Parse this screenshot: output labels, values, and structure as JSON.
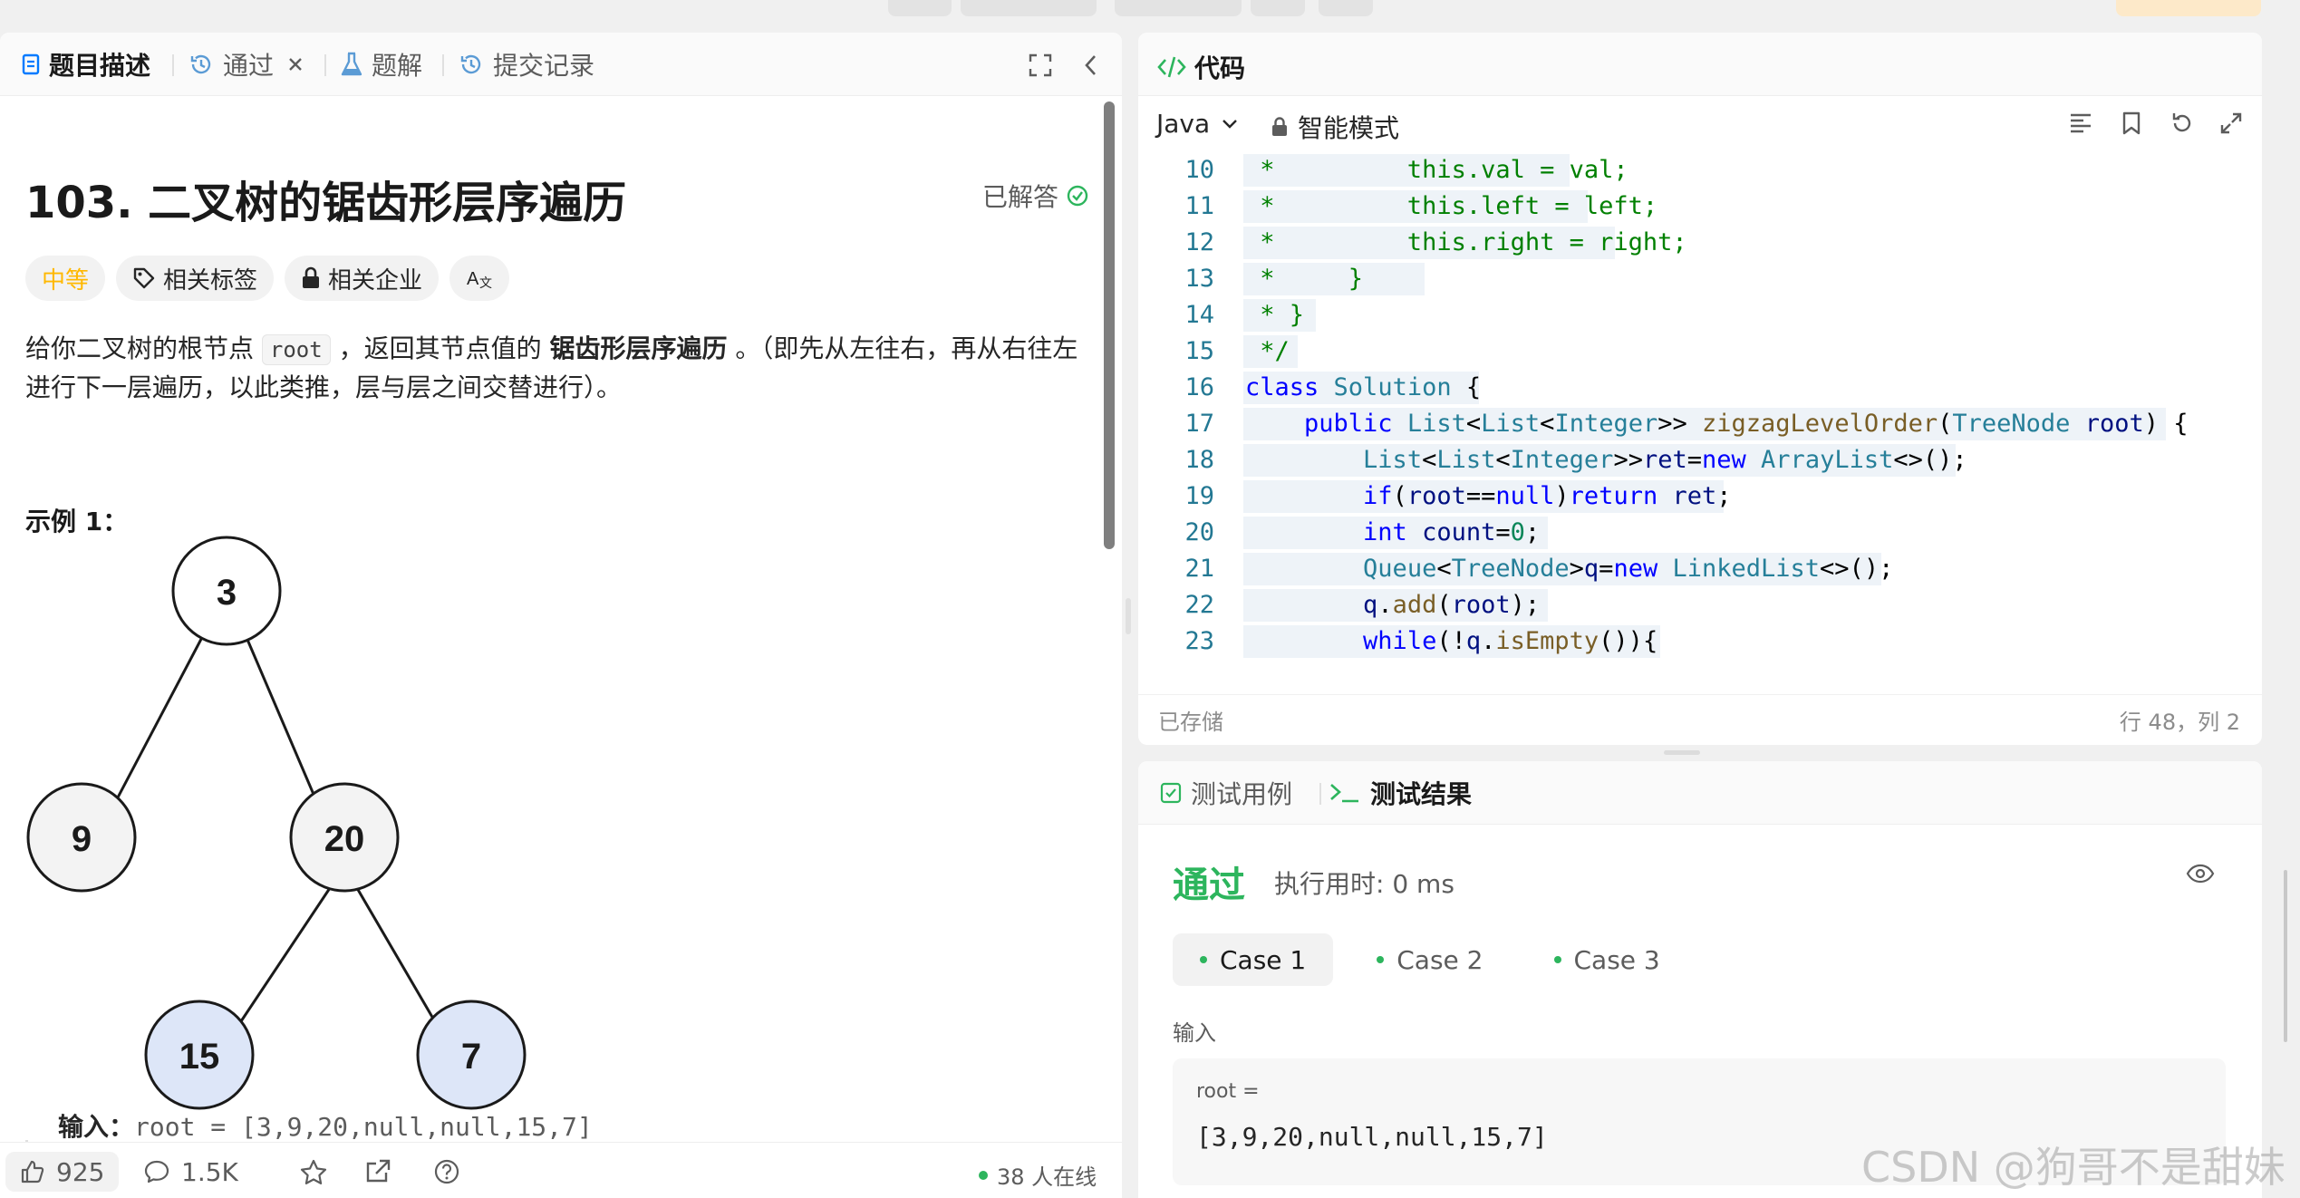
{
  "left_tabs": [
    {
      "label": "题目描述",
      "icon": "description-icon",
      "active": true
    },
    {
      "label": "通过",
      "icon": "history-icon",
      "closable": true
    },
    {
      "label": "题解",
      "icon": "flask-icon"
    },
    {
      "label": "提交记录",
      "icon": "history-icon"
    }
  ],
  "problem": {
    "title": "103. 二叉树的锯齿形层序遍历",
    "status": "已解答",
    "difficulty": "中等",
    "tags": [
      "相关标签",
      "相关企业"
    ],
    "desc_1": "给你二叉树的根节点 ",
    "desc_code": "root",
    "desc_2": " ，返回其节点值的 ",
    "desc_bold": "锯齿形层序遍历",
    "desc_3": " 。（即先从左往右，再从右往左进行下一层遍历，以此类推，层与层之间交替进行）。",
    "example_title": "示例 1：",
    "tree_nodes": [
      "3",
      "9",
      "20",
      "15",
      "7"
    ],
    "input_label": "输入：",
    "input_value": "root = [3,9,20,null,null,15,7]"
  },
  "bottom_bar": {
    "likes": "925",
    "comments": "1.5K",
    "online": "38 人在线"
  },
  "code_panel": {
    "title": "代码",
    "language": "Java",
    "mode": "智能模式",
    "saved": "已存储",
    "cursor": "行 48，列 2"
  },
  "code_lines": [
    {
      "n": "10",
      "t": " *         this.val = val;"
    },
    {
      "n": "11",
      "t": " *         this.left = left;"
    },
    {
      "n": "12",
      "t": " *         this.right = right;"
    },
    {
      "n": "13",
      "t": " *     }"
    },
    {
      "n": "14",
      "t": " * }"
    },
    {
      "n": "15",
      "t": " */"
    },
    {
      "n": "16",
      "t": "class Solution {"
    },
    {
      "n": "17",
      "t": "    public List<List<Integer>> zigzagLevelOrder(TreeNode root) {"
    },
    {
      "n": "18",
      "t": "        List<List<Integer>>ret=new ArrayList<>();"
    },
    {
      "n": "19",
      "t": "        if(root==null)return ret;"
    },
    {
      "n": "20",
      "t": "        int count=0;"
    },
    {
      "n": "21",
      "t": "        Queue<TreeNode>q=new LinkedList<>();"
    },
    {
      "n": "22",
      "t": "        q.add(root);"
    },
    {
      "n": "23",
      "t": "        while(!q.isEmpty()){"
    }
  ],
  "result_panel": {
    "tab_cases": "测试用例",
    "tab_result": "测试结果",
    "status": "通过",
    "runtime": "执行用时: 0 ms",
    "cases": [
      "Case 1",
      "Case 2",
      "Case 3"
    ],
    "input_label": "输入",
    "var_name": "root =",
    "var_value": "[3,9,20,null,null,15,7]"
  },
  "watermark": "CSDN @狗哥不是甜妹",
  "colors": {
    "accent_green": "#2db55d",
    "difficulty_medium": "#ffb800",
    "tree_node_leaf": "#dde6f8"
  }
}
